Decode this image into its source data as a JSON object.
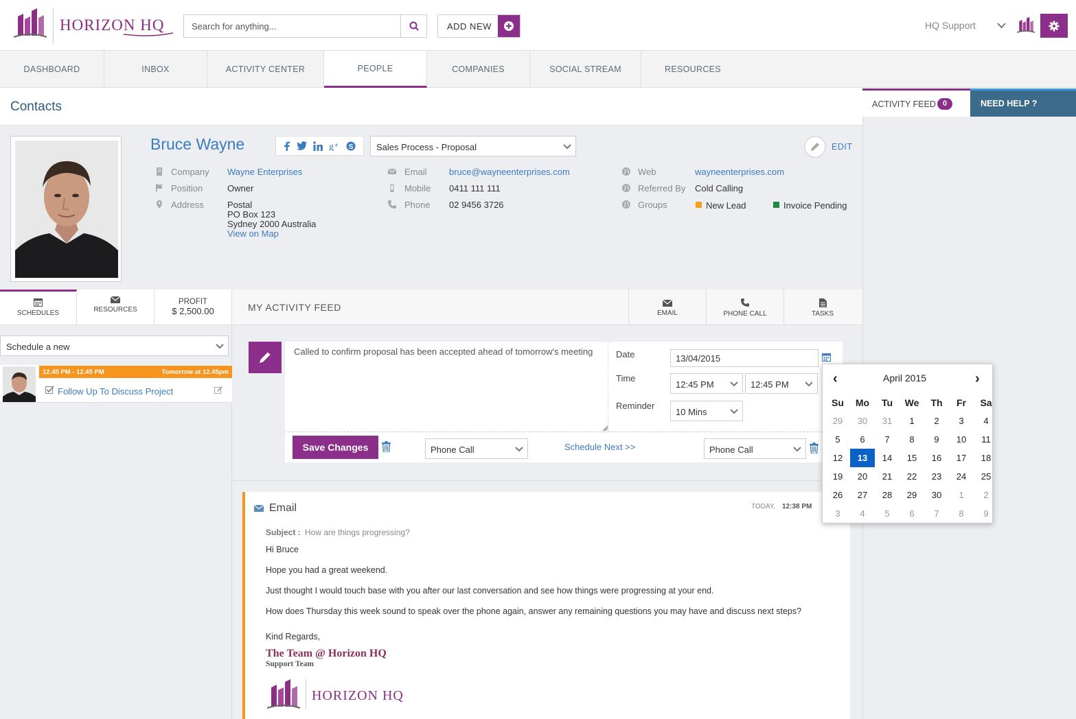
{
  "header": {
    "brand": "HORIZON HQ",
    "search_placeholder": "Search for anything...",
    "add_new_label": "ADD NEW",
    "user_name": "HQ Support",
    "accent": "#8b2f8a"
  },
  "nav": {
    "tabs": [
      "DASHBOARD",
      "INBOX",
      "ACTIVITY CENTER",
      "PEOPLE",
      "COMPANIES",
      "SOCIAL STREAM",
      "RESOURCES"
    ],
    "active": "PEOPLE"
  },
  "page_title": "Contacts",
  "contact": {
    "name": "Bruce Wayne",
    "sales_process": "Sales Process - Proposal",
    "edit_label": "EDIT",
    "company_label": "Company",
    "company": "Wayne Enterprises",
    "position_label": "Position",
    "position": "Owner",
    "address_label": "Address",
    "address_lines": [
      "Postal",
      "PO Box 123",
      "Sydney 2000 Australia"
    ],
    "map_link": "View on Map",
    "email_label": "Email",
    "email": "bruce@wayneenterprises.com",
    "mobile_label": "Mobile",
    "mobile": "0411 111 111",
    "phone_label": "Phone",
    "phone": "02 9456 3726",
    "web_label": "Web",
    "web": "wayneenterprises.com",
    "referred_label": "Referred By",
    "referred": "Cold Calling",
    "groups_label": "Groups",
    "groups": [
      {
        "name": "New Lead",
        "color": "#f6a21d"
      },
      {
        "name": "Invoice Pending",
        "color": "#1e8a3c"
      }
    ]
  },
  "left_tabs": {
    "schedules": "SCHEDULES",
    "resources": "RESOURCES",
    "profit_label": "PROFIT",
    "profit_value": "$ 2,500.00"
  },
  "schedule": {
    "select_value": "Schedule a new",
    "item_time": "12.45 PM - 12.45 PM",
    "item_when": "Tomorrow at 12.45pm",
    "item_title": "Follow Up To Discuss Project",
    "bar_color": "#f6941d"
  },
  "feed": {
    "title": "MY ACTIVITY FEED",
    "tabs": [
      "EMAIL",
      "PHONE CALL",
      "TASKS"
    ],
    "note_text": "Called to confirm proposal has been accepted ahead of tomorrow's meeting",
    "date_label": "Date",
    "date_value": "13/04/2015",
    "time_label": "Time",
    "time_from": "12:45 PM",
    "time_to": "12:45 PM",
    "reminder_label": "Reminder",
    "reminder_value": "10 Mins",
    "save_label": "Save Changes",
    "type_1": "Phone Call",
    "schedule_next": "Schedule Next >>",
    "type_2": "Phone Call"
  },
  "email": {
    "heading": "Email",
    "time_prefix": "TODAY,",
    "time": "12:38 PM",
    "subject_label": "Subject :",
    "subject": "How are things progressing?",
    "greeting": "Hi Bruce",
    "p1": "Hope you had a great weekend.",
    "p2": "Just thought I would touch base with you after our last conversation and see how things were progressing at your end.",
    "p3": "How does Thursday this week sound to speak over the phone again, answer any remaining questions you may have and discuss next steps?",
    "signoff": "Kind Regards,",
    "sig_name": "The Team @ Horizon HQ",
    "sig_role": "Support Team",
    "sig_brand": "HORIZON HQ"
  },
  "right_panel": {
    "activity_label": "ACTIVITY FEED",
    "activity_count": "0",
    "help_label": "NEED HELP ?"
  },
  "calendar": {
    "month": "April 2015",
    "prev": "‹",
    "next": "›",
    "weekdays": [
      "Su",
      "Mo",
      "Tu",
      "We",
      "Th",
      "Fr",
      "Sa"
    ],
    "weeks": [
      [
        "29",
        "30",
        "31",
        "1",
        "2",
        "3",
        "4"
      ],
      [
        "5",
        "6",
        "7",
        "8",
        "9",
        "10",
        "11"
      ],
      [
        "12",
        "13",
        "14",
        "15",
        "16",
        "17",
        "18"
      ],
      [
        "19",
        "20",
        "21",
        "22",
        "23",
        "24",
        "25"
      ],
      [
        "26",
        "27",
        "28",
        "29",
        "30",
        "1",
        "2"
      ],
      [
        "3",
        "4",
        "5",
        "6",
        "7",
        "8",
        "9"
      ]
    ],
    "selected": "13"
  }
}
